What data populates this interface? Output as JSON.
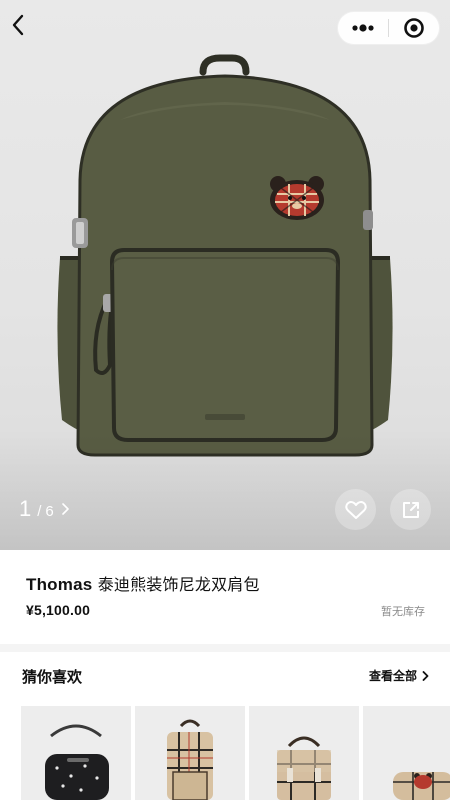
{
  "product": {
    "brand": "Thomas",
    "name": "泰迪熊装饰尼龙双肩包",
    "price": "¥5,100.00",
    "stock_status": "暂无库存"
  },
  "gallery": {
    "current": "1",
    "separator": "/",
    "total": "6"
  },
  "recommendations": {
    "title": "猜你喜欢",
    "view_all": "查看全部"
  },
  "icons": {
    "back": "chevron-left-icon",
    "more": "more-dots-icon",
    "close": "mini-program-close-icon",
    "favorite": "heart-icon",
    "share": "share-icon"
  },
  "colors": {
    "bag_olive": "#585c43",
    "page_bg": "#ffffff",
    "stock_gray": "#8a8a8a"
  }
}
